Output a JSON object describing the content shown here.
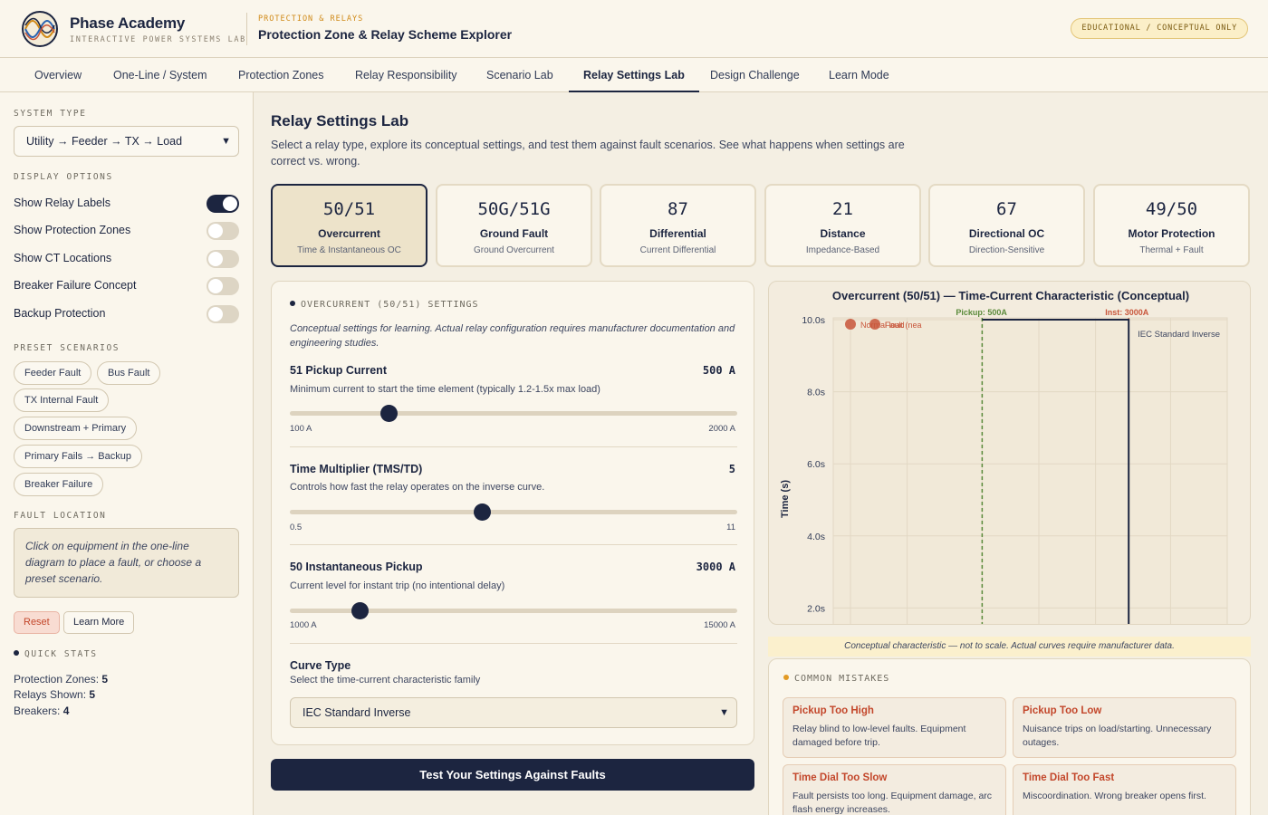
{
  "header": {
    "brand_name": "Phase Academy",
    "brand_sub": "INTERACTIVE POWER SYSTEMS LAB",
    "kicker": "PROTECTION & RELAYS",
    "title": "Protection Zone & Relay Scheme Explorer",
    "badge": "EDUCATIONAL / CONCEPTUAL ONLY"
  },
  "tabs": [
    {
      "label": "Overview",
      "active": false
    },
    {
      "label": "One-Line / System",
      "active": false
    },
    {
      "label": "Protection Zones",
      "active": false
    },
    {
      "label": "Relay Responsibility",
      "active": false
    },
    {
      "label": "Scenario Lab",
      "active": false
    },
    {
      "label": "Relay Settings Lab",
      "active": true
    },
    {
      "label": "Design Challenge",
      "active": false
    },
    {
      "label": "Learn Mode",
      "active": false
    }
  ],
  "sidebar": {
    "system_type_label": "SYSTEM TYPE",
    "system_type_value": "Utility → Feeder → TX → Load",
    "display_label": "DISPLAY OPTIONS",
    "options": [
      {
        "label": "Show Relay Labels",
        "on": true
      },
      {
        "label": "Show Protection Zones",
        "on": false
      },
      {
        "label": "Show CT Locations",
        "on": false
      },
      {
        "label": "Breaker Failure Concept",
        "on": false
      },
      {
        "label": "Backup Protection",
        "on": false
      }
    ],
    "preset_label": "PRESET SCENARIOS",
    "presets": [
      "Feeder Fault",
      "Bus Fault",
      "TX Internal Fault",
      "Downstream + Primary",
      "Primary Fails → Backup",
      "Breaker Failure"
    ],
    "fault_label": "FAULT LOCATION",
    "fault_text": "Click on equipment in the one-line diagram to place a fault, or choose a preset scenario.",
    "reset_label": "Reset",
    "learn_more_label": "Learn More",
    "stats_label": "QUICK STATS",
    "stats": [
      {
        "label": "Protection Zones:",
        "value": "5"
      },
      {
        "label": "Relays Shown:",
        "value": "5"
      },
      {
        "label": "Breakers:",
        "value": "4"
      }
    ]
  },
  "main": {
    "title": "Relay Settings Lab",
    "description": "Select a relay type, explore its conceptual settings, and test them against fault scenarios. See what happens when settings are correct vs. wrong.",
    "relays": [
      {
        "code": "50/51",
        "name": "Overcurrent",
        "sub": "Time & Instantaneous OC",
        "active": true
      },
      {
        "code": "50G/51G",
        "name": "Ground Fault",
        "sub": "Ground Overcurrent",
        "active": false
      },
      {
        "code": "87",
        "name": "Differential",
        "sub": "Current Differential",
        "active": false
      },
      {
        "code": "21",
        "name": "Distance",
        "sub": "Impedance-Based",
        "active": false
      },
      {
        "code": "67",
        "name": "Directional OC",
        "sub": "Direction-Sensitive",
        "active": false
      },
      {
        "code": "49/50",
        "name": "Motor Protection",
        "sub": "Thermal + Fault",
        "active": false
      }
    ]
  },
  "settings": {
    "title": "OVERCURRENT (50/51) SETTINGS",
    "note": "Conceptual settings for learning. Actual relay configuration requires manufacturer documentation and engineering studies.",
    "sliders": [
      {
        "label": "51 Pickup Current",
        "value": "500 A",
        "desc": "Minimum current to start the time element (typically 1.2-1.5x max load)",
        "min": "100 A",
        "max": "2000 A",
        "fraction": 0.22
      },
      {
        "label": "Time Multiplier (TMS/TD)",
        "value": "5",
        "desc": "Controls how fast the relay operates on the inverse curve.",
        "min": "0.5",
        "max": "11",
        "fraction": 0.43
      },
      {
        "label": "50 Instantaneous Pickup",
        "value": "3000 A",
        "desc": "Current level for instant trip (no intentional delay)",
        "min": "1000 A",
        "max": "15000 A",
        "fraction": 0.155
      }
    ],
    "curve_label": "Curve Type",
    "curve_desc": "Select the time-current characteristic family",
    "curve_value": "IEC Standard Inverse",
    "test_button": "Test Your Settings Against Faults"
  },
  "chart_data": {
    "type": "line",
    "title": "Overcurrent (50/51) — Time-Current Characteristic (Conceptual)",
    "ylabel": "Time (s)",
    "y_ticks": [
      "10.0s",
      "8.0s",
      "6.0s",
      "4.0s",
      "2.0s"
    ],
    "ylim_visible": [
      1.6,
      10.0
    ],
    "series": [
      {
        "name": "IEC Standard Inverse",
        "x": [
          500,
          600,
          800,
          1000,
          1500,
          2000,
          2999,
          3000,
          5000
        ],
        "y": [
          10.0,
          10.0,
          10.0,
          10.0,
          10.0,
          10.0,
          10.0,
          0.0,
          0.0
        ]
      }
    ],
    "markers": [
      {
        "label": "Pickup: 500A",
        "current": 500
      },
      {
        "label": "Inst: 3000A",
        "current": 3000
      }
    ],
    "points": [
      {
        "label": "Normal load",
        "current": 100,
        "time": 10.0
      },
      {
        "label": "Fault (nea",
        "current": 250,
        "time": 10.0
      }
    ],
    "curve_label": "IEC Standard Inverse",
    "note": "Conceptual characteristic — not to scale. Actual curves require manufacturer data."
  },
  "mistakes": {
    "title": "COMMON MISTAKES",
    "items": [
      {
        "title": "Pickup Too High",
        "desc": "Relay blind to low-level faults. Equipment damaged before trip."
      },
      {
        "title": "Pickup Too Low",
        "desc": "Nuisance trips on load/starting. Unnecessary outages."
      },
      {
        "title": "Time Dial Too Slow",
        "desc": "Fault persists too long. Equipment damage, arc flash energy increases."
      },
      {
        "title": "Time Dial Too Fast",
        "desc": "Miscoordination. Wrong breaker opens first."
      }
    ]
  },
  "colors": {
    "navy": "#1c2540",
    "accent": "#d08a18",
    "pickup": "#5a8a3a",
    "inst": "#c8553a",
    "background": "#f4efe3"
  }
}
